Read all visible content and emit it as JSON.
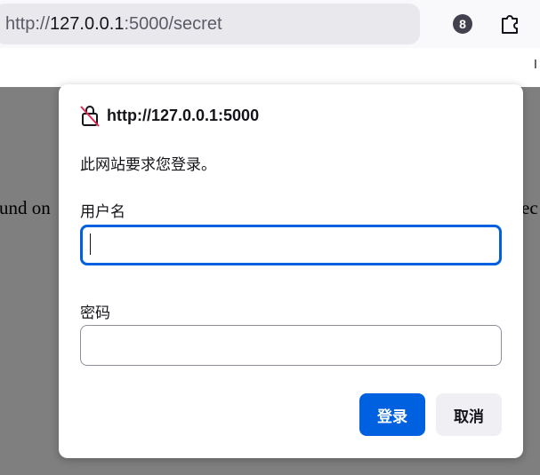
{
  "browser": {
    "url_scheme": "http://",
    "url_host": "127.0.0.1",
    "url_rest": ":5000/secret",
    "badge_count": "8",
    "extensions_icon": "puzzle-piece-icon",
    "bookmark_edge_left": "Ⅰ",
    "bookmark_edge_right": "Ⅰ"
  },
  "page": {
    "text_left": "und on",
    "text_right": "ec"
  },
  "dialog": {
    "origin_icon": "lock-slash-icon",
    "origin": "http://127.0.0.1:5000",
    "message": "此网站要求您登录。",
    "username_label": "用户名",
    "username_value": "",
    "password_label": "密码",
    "password_value": "",
    "login_label": "登录",
    "cancel_label": "取消"
  },
  "colors": {
    "accent": "#0061e0",
    "overlay": "#7f7f7f"
  }
}
